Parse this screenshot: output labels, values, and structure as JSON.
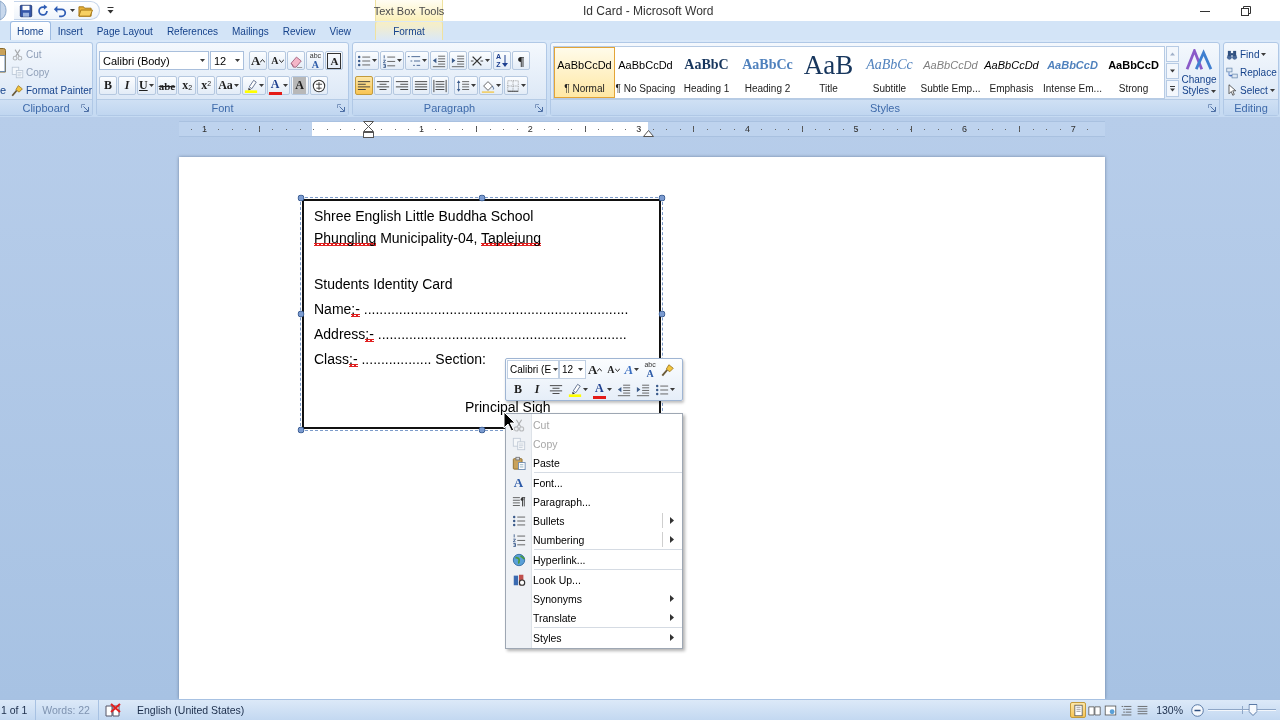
{
  "window": {
    "title": "Id Card - Microsoft Word",
    "contextual_group": "Text Box Tools"
  },
  "tabs": [
    {
      "label": "Home",
      "selected": true,
      "kind": "main"
    },
    {
      "label": "Insert",
      "selected": false,
      "kind": "main"
    },
    {
      "label": "Page Layout",
      "selected": false,
      "kind": "main"
    },
    {
      "label": "References",
      "selected": false,
      "kind": "main"
    },
    {
      "label": "Mailings",
      "selected": false,
      "kind": "main"
    },
    {
      "label": "Review",
      "selected": false,
      "kind": "main"
    },
    {
      "label": "View",
      "selected": false,
      "kind": "main"
    },
    {
      "label": "Format",
      "selected": false,
      "kind": "contextual"
    }
  ],
  "clipboard": {
    "label": "Clipboard",
    "paste_label": "e",
    "items": [
      {
        "label": "Cut",
        "kind": "scissors",
        "disabled": true
      },
      {
        "label": "Copy",
        "kind": "copy",
        "disabled": true
      },
      {
        "label": "Format Painter",
        "kind": "brush",
        "disabled": false
      }
    ]
  },
  "font": {
    "label": "Font",
    "font_name": "Calibri (Body)",
    "font_size": "12",
    "row_1": [
      {
        "kind": "grow",
        "glyph": "A"
      },
      {
        "kind": "shrink",
        "glyph": "A"
      },
      {
        "kind": "eraser"
      },
      {
        "kind": "phonetic",
        "glyph": "A",
        "small": "abc"
      },
      {
        "kind": "boxed",
        "glyph": "A"
      }
    ],
    "row_2": [
      {
        "kind": "bold",
        "glyph": "B"
      },
      {
        "kind": "italic",
        "glyph": "I"
      },
      {
        "kind": "underline",
        "glyph": "U",
        "dropdown": true
      },
      {
        "kind": "strike",
        "glyph": "abe"
      },
      {
        "kind": "subscript",
        "glyph": "x",
        "small": "2"
      },
      {
        "kind": "superscript",
        "glyph": "x",
        "small": "2"
      },
      {
        "kind": "case",
        "glyph": "Aa",
        "dropdown": true
      },
      {
        "kind": "highlighter",
        "dropdown": true
      },
      {
        "kind": "fontcolor",
        "glyph": "A",
        "dropdown": true
      },
      {
        "kind": "shaded",
        "glyph": "A"
      },
      {
        "kind": "enclose"
      }
    ]
  },
  "paragraph": {
    "label": "Paragraph",
    "row_1": [
      {
        "kind": "bullets",
        "dropdown": true
      },
      {
        "kind": "numbering",
        "dropdown": true
      },
      {
        "kind": "multilevel",
        "dropdown": true
      },
      {
        "kind": "outdent"
      },
      {
        "kind": "indent"
      },
      {
        "kind": "asian",
        "dropdown": true
      },
      {
        "kind": "sort",
        "glyph": "A",
        "small": "Z"
      },
      {
        "kind": "plain",
        "glyph": "¶"
      }
    ],
    "alignment": [
      {
        "kind": "left",
        "selected": true
      },
      {
        "kind": "center",
        "selected": false
      },
      {
        "kind": "right",
        "selected": false
      },
      {
        "kind": "justify",
        "selected": false
      },
      {
        "kind": "distributed",
        "selected": false
      }
    ],
    "row_2": [
      {
        "kind": "linespacing",
        "dropdown": true
      },
      {
        "kind": "shading",
        "dropdown": true
      },
      {
        "kind": "borders",
        "dropdown": true
      }
    ]
  },
  "styles": {
    "label": "Styles",
    "items": [
      {
        "kind": "normal",
        "preview": "AaBbCcDd",
        "label": "¶ Normal",
        "selected": true
      },
      {
        "kind": "normal",
        "preview": "AaBbCcDd",
        "label": "¶ No Spacing",
        "selected": false
      },
      {
        "kind": "heading1",
        "preview": "AaBbC",
        "label": "Heading 1",
        "selected": false
      },
      {
        "kind": "heading2",
        "preview": "AaBbCc",
        "label": "Heading 2",
        "selected": false
      },
      {
        "kind": "title",
        "preview": "AaB",
        "label": "Title",
        "selected": false
      },
      {
        "kind": "subtitle",
        "preview": "AaBbCc",
        "label": "Subtitle",
        "selected": false
      },
      {
        "kind": "subtle",
        "preview": "AaBbCcDd",
        "label": "Subtle Emp...",
        "selected": false
      },
      {
        "kind": "emphasis",
        "preview": "AaBbCcDd",
        "label": "Emphasis",
        "selected": false
      },
      {
        "kind": "intense",
        "preview": "AaBbCcD",
        "label": "Intense Em...",
        "selected": false
      },
      {
        "kind": "strong",
        "preview": "AaBbCcD",
        "label": "Strong",
        "selected": false
      }
    ],
    "change_styles": "Change Styles"
  },
  "editing": {
    "label": "Editing",
    "items": [
      {
        "kind": "find",
        "label": "Find",
        "dropdown": true
      },
      {
        "kind": "replace",
        "label": "Replace"
      },
      {
        "kind": "select",
        "label": "Select",
        "dropdown": true
      }
    ]
  },
  "ruler": {
    "labels": [
      "1",
      "1",
      "2",
      "3",
      "4",
      "5",
      "6",
      "7"
    ]
  },
  "document": {
    "textbox": {
      "header_lines": [
        {
          "segments": [
            {
              "text": "Shree English Little Buddha School",
              "flagged": false
            }
          ]
        },
        {
          "segments": [
            {
              "text": "Phungling",
              "flagged": true
            },
            {
              "text": " Municipality-04, ",
              "flagged": false
            },
            {
              "text": "Taplejung",
              "flagged": true
            }
          ]
        }
      ],
      "body_lines": [
        {
          "segments": [
            {
              "text": "Students Identity Card",
              "flagged": false
            }
          ]
        },
        {
          "segments": [
            {
              "text": "Name",
              "flagged": false
            },
            {
              "text": ":-",
              "flagged": true
            },
            {
              "text": " ....................................................................",
              "flagged": false
            }
          ]
        },
        {
          "segments": [
            {
              "text": "Address",
              "flagged": false
            },
            {
              "text": ":-",
              "flagged": true
            },
            {
              "text": " ................................................................",
              "flagged": false
            }
          ]
        },
        {
          "segments": [
            {
              "text": "Class",
              "flagged": false
            },
            {
              "text": ":-",
              "flagged": true
            },
            {
              "text": " .................. Section:",
              "flagged": false
            }
          ]
        }
      ],
      "signature": "Principal Sigh"
    }
  },
  "mini_toolbar": {
    "font_name": "Calibri (E",
    "font_size": "12",
    "row_1": [
      {
        "kind": "grow",
        "glyph": "A"
      },
      {
        "kind": "shrink",
        "glyph": "A"
      },
      {
        "kind": "quickstyles",
        "glyph": "A",
        "dropdown": true
      },
      {
        "kind": "phonetic",
        "glyph": "A",
        "small": "abc"
      },
      {
        "kind": "brush"
      }
    ],
    "row_2": [
      {
        "kind": "bold",
        "glyph": "B"
      },
      {
        "kind": "italic",
        "glyph": "I"
      },
      {
        "kind": "center"
      },
      {
        "kind": "highlighter",
        "dropdown": true
      },
      {
        "kind": "fontcolor",
        "glyph": "A",
        "dropdown": true
      },
      {
        "kind": "outdent"
      },
      {
        "kind": "indent"
      },
      {
        "kind": "bullets",
        "dropdown": true
      }
    ]
  },
  "context_menu": {
    "groups": [
      {
        "items": [
          {
            "kind": "scissors",
            "label": "Cut",
            "disabled": true
          },
          {
            "kind": "copy",
            "label": "Copy",
            "disabled": true
          },
          {
            "kind": "paste",
            "label": "Paste",
            "disabled": false
          }
        ]
      },
      {
        "items": [
          {
            "kind": "font",
            "glyph": "A",
            "label": "Font...",
            "disabled": false
          },
          {
            "kind": "paragraph",
            "label": "Paragraph...",
            "disabled": false
          },
          {
            "kind": "bullets",
            "label": "Bullets",
            "disabled": false,
            "submenu": true,
            "split": true
          },
          {
            "kind": "numbering",
            "label": "Numbering",
            "disabled": false,
            "submenu": true,
            "split": true
          }
        ]
      },
      {
        "items": [
          {
            "kind": "globe",
            "label": "Hyperlink...",
            "disabled": false
          }
        ]
      },
      {
        "items": [
          {
            "kind": "book",
            "label": "Look Up...",
            "disabled": false
          },
          {
            "kind": "plain",
            "label": "Synonyms",
            "disabled": false,
            "submenu": true
          },
          {
            "kind": "plain",
            "label": "Translate",
            "disabled": false,
            "submenu": true
          }
        ]
      },
      {
        "items": [
          {
            "kind": "plain",
            "label": "Styles",
            "disabled": false,
            "submenu": true
          }
        ]
      }
    ]
  },
  "status_bar": {
    "page": "1 of 1",
    "words": "Words: 22",
    "language": "English (United States)",
    "views": [
      {
        "kind": "print",
        "selected": true
      },
      {
        "kind": "reading",
        "selected": false
      },
      {
        "kind": "web",
        "selected": false
      },
      {
        "kind": "outline",
        "selected": false
      },
      {
        "kind": "draft",
        "selected": false
      }
    ],
    "zoom": "130%",
    "zoom_slider": {
      "level": 0.66
    }
  }
}
